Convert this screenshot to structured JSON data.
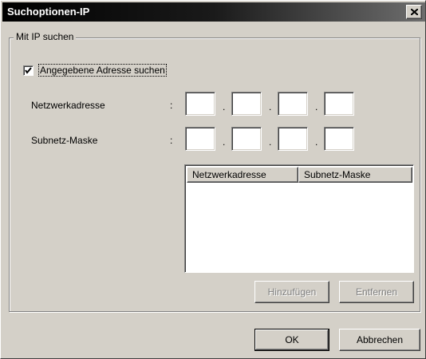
{
  "window": {
    "title": "Suchoptionen-IP",
    "close_icon": "close-icon"
  },
  "group": {
    "label": "Mit IP suchen",
    "checkbox_label": "Angegebene Adresse suchen",
    "checkbox_checked": true,
    "network_label": "Netzwerkadresse",
    "subnet_label": "Subnetz-Maske",
    "colon": ":",
    "dot": ".",
    "network_octets": [
      "",
      "",
      "",
      ""
    ],
    "subnet_octets": [
      "",
      "",
      "",
      ""
    ]
  },
  "address_list": {
    "columns": [
      "Netzwerkadresse",
      "Subnetz-Maske"
    ],
    "rows": []
  },
  "buttons": {
    "add": "Hinzufügen",
    "remove": "Entfernen",
    "ok": "OK",
    "cancel": "Abbrechen"
  },
  "colors": {
    "face": "#d4d0c8",
    "title_start": "#000000",
    "title_end": "#6e6e6e"
  }
}
